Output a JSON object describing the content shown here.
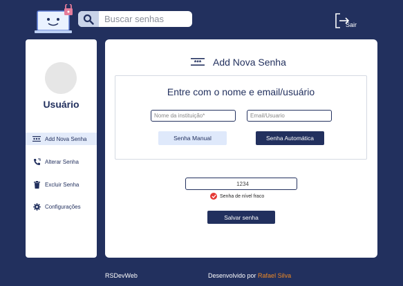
{
  "header": {
    "search_placeholder": "Buscar senhas",
    "exit_label": "Sair"
  },
  "sidebar": {
    "username": "Usuário",
    "items": [
      {
        "label": "Add Nova Senha",
        "icon": "password-icon",
        "active": true
      },
      {
        "label": "Alterar Senha",
        "icon": "swap-phone-icon",
        "active": false
      },
      {
        "label": "Excluir Senha",
        "icon": "trash-icon",
        "active": false
      },
      {
        "label": "Configurações",
        "icon": "gear-icon",
        "active": false
      }
    ]
  },
  "main": {
    "title": "Add Nova Senha",
    "panel_title": "Entre com o nome e email/usuário",
    "institution_placeholder": "Nome da instituição*",
    "email_placeholder": "Email/Usuario",
    "manual_button": "Senha Manual",
    "auto_button": "Senha Automática",
    "password_value": "1234",
    "strength_label": "Senha de nível fraco",
    "save_button": "Salvar senha"
  },
  "footer": {
    "brand": "RSDevWeb",
    "credit_prefix": "Desenvolvido por ",
    "credit_author": "Rafael Silva"
  },
  "colors": {
    "background": "#22305e",
    "accent_light": "#dfe9fb",
    "author": "#f08a24",
    "strength_weak": "#e53935"
  }
}
